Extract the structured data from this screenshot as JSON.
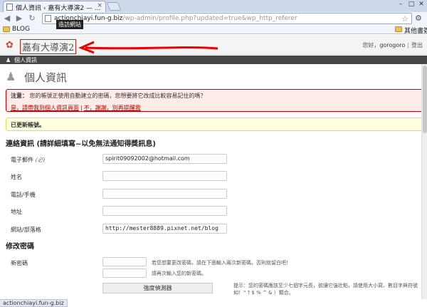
{
  "browser": {
    "tab_title": "個人資訊 ‹ 嘉有大導演2 — ...",
    "tab_close": "×",
    "address_host": "actionchiayi.fun-g.biz",
    "address_path": "/wp-admin/profile.php?updated=true&wp_http_referer",
    "bookmark_left": "BLOG",
    "bookmark_right": "其他書簽",
    "status": "actionchiayi.fun-g.biz"
  },
  "header": {
    "site_title": "嘉有大導演2",
    "visit_site": "造訪網站",
    "howdy": "您好，",
    "user": "gorogoro",
    "logout": "登出"
  },
  "menu": {
    "profile": "個人資訊"
  },
  "page": {
    "title": "個人資訊"
  },
  "notices": {
    "error_label": "注意：",
    "error_text": "您的帳號正使用自動建立的密碼，您想要將它改成比較容易記住的嗎？",
    "error_link_yes": "是，請帶我到個人資訊頁面",
    "error_link_no": "不，謝謝，別再提醒我",
    "updated": "已更新帳號。"
  },
  "contact": {
    "section_title": "連絡資訊 (請詳細填寫~以免無法通知得獎訊息)",
    "email_label": "電子郵件",
    "email_hint": "(必)",
    "email_value": "spirit09092002@hotmail.com",
    "name_label": "姓名",
    "name_value": "",
    "phone_label": "電話/手機",
    "phone_value": "",
    "address_label": "地址",
    "address_value": "",
    "website_label": "網站/部落格",
    "website_value": "http://mester8889.pixnet.net/blog"
  },
  "password": {
    "section_title": "修改密碼",
    "new_label": "新密碼",
    "hint1": "若您想要更改密碼，請在下面輸入兩次新密碼，否則就留白吧！",
    "hint2": "請再次輸入您的新密碼。",
    "strength_button": "強度偵測器",
    "strength_tip": "提示：您的密碼應該至少七個字元長，欲讓它強壯點，請使用大小寫、數目字與符號如！\" ? $ % ^ & ）類合。"
  }
}
